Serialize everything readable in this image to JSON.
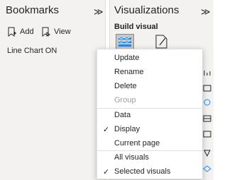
{
  "bookmarks": {
    "title": "Bookmarks",
    "collapse_glyph": "≫",
    "add_label": "Add",
    "view_label": "View",
    "items": [
      "Line Chart ON"
    ]
  },
  "visualizations": {
    "title": "Visualizations",
    "collapse_glyph": "≫",
    "subtitle": "Build visual"
  },
  "menu": {
    "items": [
      {
        "label": "Update",
        "disabled": false,
        "checked": false
      },
      {
        "label": "Rename",
        "disabled": false,
        "checked": false
      },
      {
        "label": "Delete",
        "disabled": false,
        "checked": false
      },
      {
        "label": "Group",
        "disabled": true,
        "checked": false
      },
      {
        "label": "Data",
        "disabled": false,
        "checked": false
      },
      {
        "label": "Display",
        "disabled": false,
        "checked": true
      },
      {
        "label": "Current page",
        "disabled": false,
        "checked": false
      },
      {
        "label": "All visuals",
        "disabled": false,
        "checked": false
      },
      {
        "label": "Selected visuals",
        "disabled": false,
        "checked": true
      }
    ],
    "check_glyph": "✓"
  }
}
